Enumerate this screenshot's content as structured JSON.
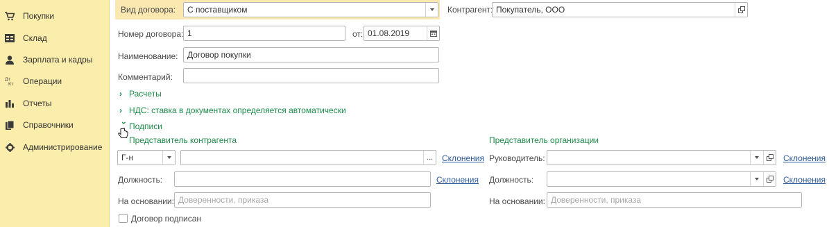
{
  "sidebar": {
    "items": [
      {
        "label": "Покупки",
        "icon": "shopping-cart-icon"
      },
      {
        "label": "Склад",
        "icon": "warehouse-icon"
      },
      {
        "label": "Зарплата и кадры",
        "icon": "person-icon"
      },
      {
        "label": "Операции",
        "icon": "dt-kt-icon"
      },
      {
        "label": "Отчеты",
        "icon": "bar-chart-icon"
      },
      {
        "label": "Справочники",
        "icon": "books-icon"
      },
      {
        "label": "Администрирование",
        "icon": "gear-icon"
      }
    ]
  },
  "form": {
    "contract_type_label": "Вид договора:",
    "contract_type_value": "С поставщиком",
    "counterparty_label": "Контрагент:",
    "counterparty_value": "Покупатель, ООО",
    "contract_number_label": "Номер договора:",
    "contract_number_value": "1",
    "from_label": "от:",
    "date_value": "01.08.2019",
    "name_label": "Наименование:",
    "name_value": "Договор покупки",
    "comment_label": "Комментарий:",
    "comment_value": "",
    "group_settlements": "Расчеты",
    "group_vat": "НДС: ставка в документах определяется автоматически",
    "group_signatures": "Подписи"
  },
  "counterparty_rep": {
    "title": "Представитель контрагента",
    "salutation_value": "Г-н",
    "name_value": "",
    "ellipsis": "...",
    "declensions_link": "Склонения",
    "position_label": "Должность:",
    "position_value": "",
    "position_declensions_link": "Склонения",
    "basis_label": "На основании:",
    "basis_placeholder": "Доверенности, приказа"
  },
  "org_rep": {
    "title": "Представитель организации",
    "head_label": "Руководитель:",
    "head_value": "",
    "head_declensions_link": "Склонения",
    "position_label": "Должность:",
    "position_value": "",
    "position_declensions_link": "Склонения",
    "basis_label": "На основании:",
    "basis_placeholder": "Доверенности, приказа"
  },
  "signed_checkbox_label": "Договор подписан",
  "colors": {
    "sidebar_bg": "#fbedab",
    "group_green": "#1d8a4a",
    "link_blue": "#2e5c9a",
    "highlight_row": "#fbe7b0"
  }
}
